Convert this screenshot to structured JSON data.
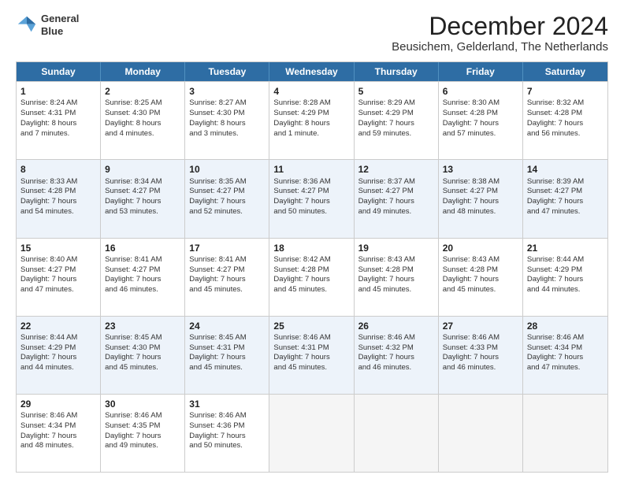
{
  "logo": {
    "line1": "General",
    "line2": "Blue"
  },
  "title": "December 2024",
  "subtitle": "Beusichem, Gelderland, The Netherlands",
  "header_days": [
    "Sunday",
    "Monday",
    "Tuesday",
    "Wednesday",
    "Thursday",
    "Friday",
    "Saturday"
  ],
  "weeks": [
    [
      {
        "day": "1",
        "info": "Sunrise: 8:24 AM\nSunset: 4:31 PM\nDaylight: 8 hours\nand 7 minutes."
      },
      {
        "day": "2",
        "info": "Sunrise: 8:25 AM\nSunset: 4:30 PM\nDaylight: 8 hours\nand 4 minutes."
      },
      {
        "day": "3",
        "info": "Sunrise: 8:27 AM\nSunset: 4:30 PM\nDaylight: 8 hours\nand 3 minutes."
      },
      {
        "day": "4",
        "info": "Sunrise: 8:28 AM\nSunset: 4:29 PM\nDaylight: 8 hours\nand 1 minute."
      },
      {
        "day": "5",
        "info": "Sunrise: 8:29 AM\nSunset: 4:29 PM\nDaylight: 7 hours\nand 59 minutes."
      },
      {
        "day": "6",
        "info": "Sunrise: 8:30 AM\nSunset: 4:28 PM\nDaylight: 7 hours\nand 57 minutes."
      },
      {
        "day": "7",
        "info": "Sunrise: 8:32 AM\nSunset: 4:28 PM\nDaylight: 7 hours\nand 56 minutes."
      }
    ],
    [
      {
        "day": "8",
        "info": "Sunrise: 8:33 AM\nSunset: 4:28 PM\nDaylight: 7 hours\nand 54 minutes."
      },
      {
        "day": "9",
        "info": "Sunrise: 8:34 AM\nSunset: 4:27 PM\nDaylight: 7 hours\nand 53 minutes."
      },
      {
        "day": "10",
        "info": "Sunrise: 8:35 AM\nSunset: 4:27 PM\nDaylight: 7 hours\nand 52 minutes."
      },
      {
        "day": "11",
        "info": "Sunrise: 8:36 AM\nSunset: 4:27 PM\nDaylight: 7 hours\nand 50 minutes."
      },
      {
        "day": "12",
        "info": "Sunrise: 8:37 AM\nSunset: 4:27 PM\nDaylight: 7 hours\nand 49 minutes."
      },
      {
        "day": "13",
        "info": "Sunrise: 8:38 AM\nSunset: 4:27 PM\nDaylight: 7 hours\nand 48 minutes."
      },
      {
        "day": "14",
        "info": "Sunrise: 8:39 AM\nSunset: 4:27 PM\nDaylight: 7 hours\nand 47 minutes."
      }
    ],
    [
      {
        "day": "15",
        "info": "Sunrise: 8:40 AM\nSunset: 4:27 PM\nDaylight: 7 hours\nand 47 minutes."
      },
      {
        "day": "16",
        "info": "Sunrise: 8:41 AM\nSunset: 4:27 PM\nDaylight: 7 hours\nand 46 minutes."
      },
      {
        "day": "17",
        "info": "Sunrise: 8:41 AM\nSunset: 4:27 PM\nDaylight: 7 hours\nand 45 minutes."
      },
      {
        "day": "18",
        "info": "Sunrise: 8:42 AM\nSunset: 4:28 PM\nDaylight: 7 hours\nand 45 minutes."
      },
      {
        "day": "19",
        "info": "Sunrise: 8:43 AM\nSunset: 4:28 PM\nDaylight: 7 hours\nand 45 minutes."
      },
      {
        "day": "20",
        "info": "Sunrise: 8:43 AM\nSunset: 4:28 PM\nDaylight: 7 hours\nand 45 minutes."
      },
      {
        "day": "21",
        "info": "Sunrise: 8:44 AM\nSunset: 4:29 PM\nDaylight: 7 hours\nand 44 minutes."
      }
    ],
    [
      {
        "day": "22",
        "info": "Sunrise: 8:44 AM\nSunset: 4:29 PM\nDaylight: 7 hours\nand 44 minutes."
      },
      {
        "day": "23",
        "info": "Sunrise: 8:45 AM\nSunset: 4:30 PM\nDaylight: 7 hours\nand 45 minutes."
      },
      {
        "day": "24",
        "info": "Sunrise: 8:45 AM\nSunset: 4:31 PM\nDaylight: 7 hours\nand 45 minutes."
      },
      {
        "day": "25",
        "info": "Sunrise: 8:46 AM\nSunset: 4:31 PM\nDaylight: 7 hours\nand 45 minutes."
      },
      {
        "day": "26",
        "info": "Sunrise: 8:46 AM\nSunset: 4:32 PM\nDaylight: 7 hours\nand 46 minutes."
      },
      {
        "day": "27",
        "info": "Sunrise: 8:46 AM\nSunset: 4:33 PM\nDaylight: 7 hours\nand 46 minutes."
      },
      {
        "day": "28",
        "info": "Sunrise: 8:46 AM\nSunset: 4:34 PM\nDaylight: 7 hours\nand 47 minutes."
      }
    ],
    [
      {
        "day": "29",
        "info": "Sunrise: 8:46 AM\nSunset: 4:34 PM\nDaylight: 7 hours\nand 48 minutes."
      },
      {
        "day": "30",
        "info": "Sunrise: 8:46 AM\nSunset: 4:35 PM\nDaylight: 7 hours\nand 49 minutes."
      },
      {
        "day": "31",
        "info": "Sunrise: 8:46 AM\nSunset: 4:36 PM\nDaylight: 7 hours\nand 50 minutes."
      },
      {
        "day": "",
        "info": ""
      },
      {
        "day": "",
        "info": ""
      },
      {
        "day": "",
        "info": ""
      },
      {
        "day": "",
        "info": ""
      }
    ]
  ]
}
